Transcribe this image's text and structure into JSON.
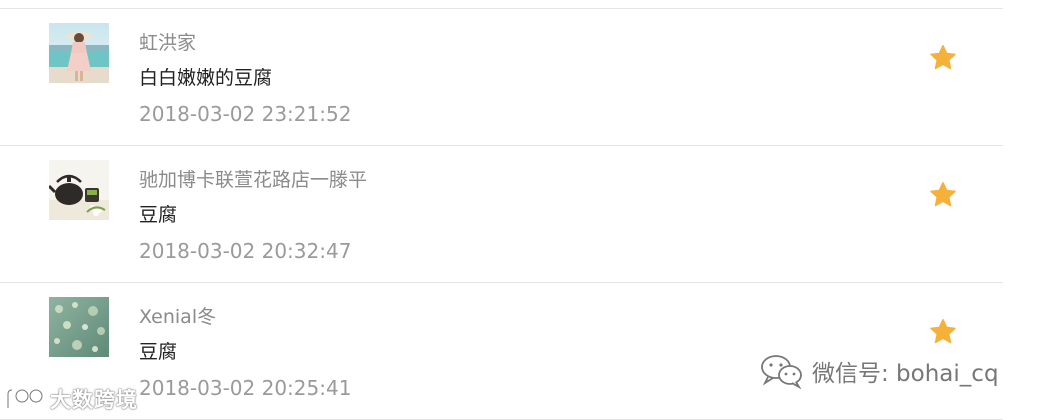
{
  "items": [
    {
      "name": "虹洪家",
      "comment": "白白嫩嫩的豆腐",
      "time": "2018-03-02 23:21:52",
      "avatar": "beach-avatar",
      "starred": true
    },
    {
      "name": "驰加博卡联萱花路店一滕平",
      "comment": "豆腐",
      "time": "2018-03-02 20:32:47",
      "avatar": "teapot-avatar",
      "starred": true
    },
    {
      "name": "Xenial冬",
      "comment": "豆腐",
      "time": "2018-03-02 20:25:41",
      "avatar": "bokeh-avatar",
      "starred": true
    }
  ],
  "colors": {
    "star": "#f5b13a",
    "name": "#8b8b8b",
    "comment": "#222222",
    "time": "#9a9a9a"
  },
  "watermark_left": "大数跨境",
  "watermark_right": "微信号: bohai_cq"
}
